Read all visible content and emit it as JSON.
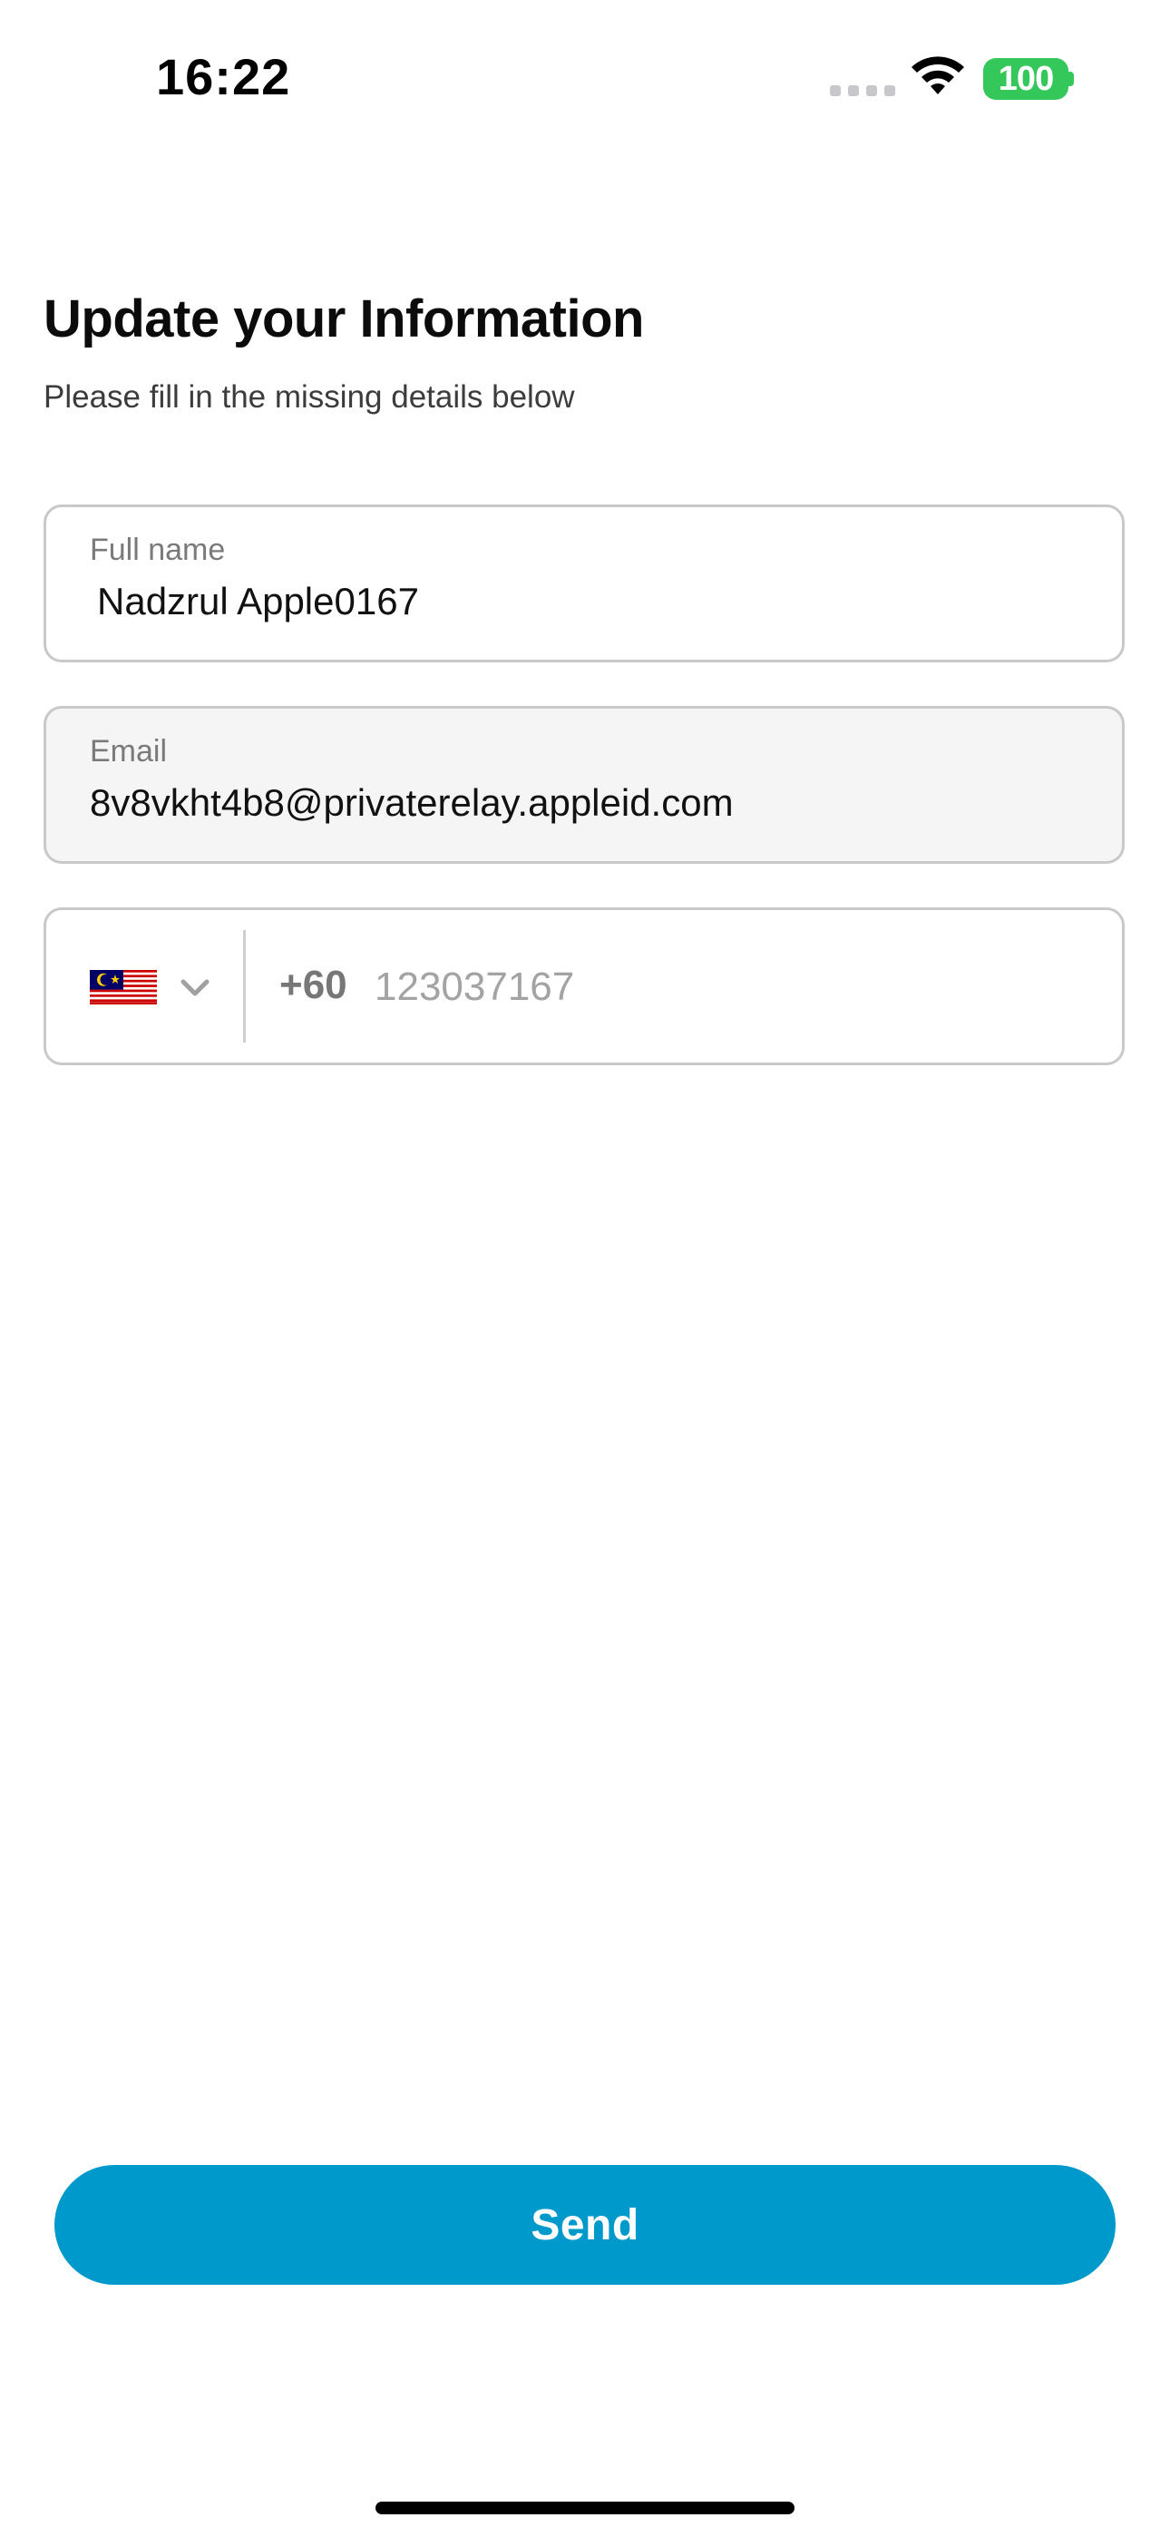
{
  "status_bar": {
    "time": "16:22",
    "battery_level": "100",
    "battery_color": "#34c759",
    "icons": [
      "signal-dots-icon",
      "wifi-icon",
      "battery-icon"
    ]
  },
  "header": {
    "title": "Update your Information",
    "subtitle": "Please fill in the missing details below"
  },
  "form": {
    "full_name": {
      "label": "Full name",
      "value": "Nadzrul Apple0167"
    },
    "email": {
      "label": "Email",
      "value": "8v8vkht4b8@privaterelay.appleid.com",
      "disabled": true
    },
    "phone": {
      "country_flag_icon": "malaysia-flag-icon",
      "dial_code": "+60",
      "placeholder": "123037167",
      "value": ""
    }
  },
  "actions": {
    "send_label": "Send",
    "accent_color": "#0099cc"
  }
}
